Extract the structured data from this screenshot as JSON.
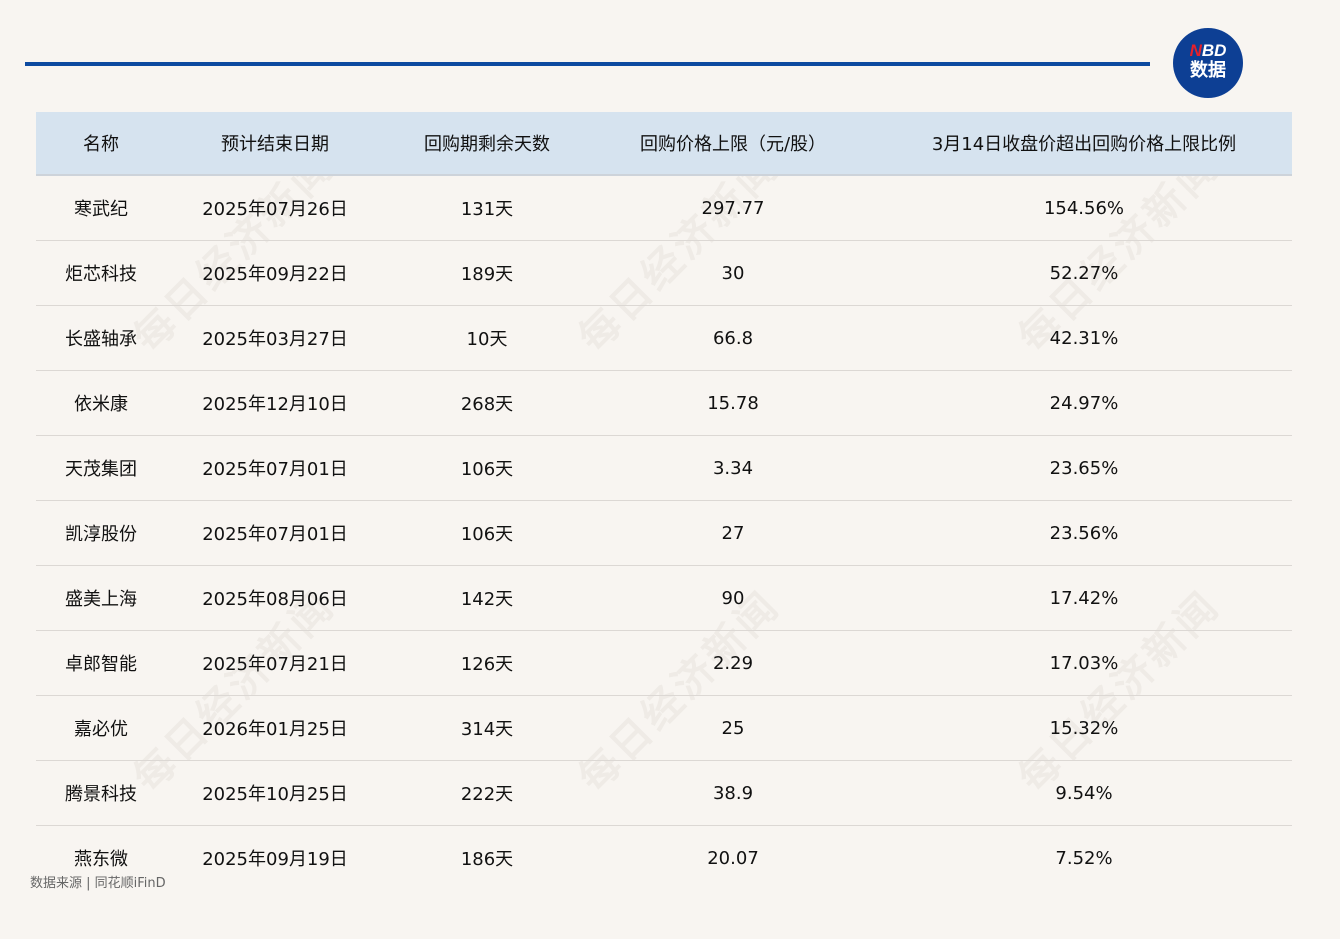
{
  "logo": {
    "brand_n": "N",
    "brand_bd": "BD",
    "subtitle": "数据"
  },
  "watermark": "每日经济新闻",
  "table": {
    "headers": [
      "名称",
      "预计结束日期",
      "回购期剩余天数",
      "回购价格上限（元/股）",
      "3月14日收盘价超出回购价格上限比例"
    ],
    "rows": [
      [
        "寒武纪",
        "2025年07月26日",
        "131天",
        "297.77",
        "154.56%"
      ],
      [
        "炬芯科技",
        "2025年09月22日",
        "189天",
        "30",
        "52.27%"
      ],
      [
        "长盛轴承",
        "2025年03月27日",
        "10天",
        "66.8",
        "42.31%"
      ],
      [
        "依米康",
        "2025年12月10日",
        "268天",
        "15.78",
        "24.97%"
      ],
      [
        "天茂集团",
        "2025年07月01日",
        "106天",
        "3.34",
        "23.65%"
      ],
      [
        "凯淳股份",
        "2025年07月01日",
        "106天",
        "27",
        "23.56%"
      ],
      [
        "盛美上海",
        "2025年08月06日",
        "142天",
        "90",
        "17.42%"
      ],
      [
        "卓郎智能",
        "2025年07月21日",
        "126天",
        "2.29",
        "17.03%"
      ],
      [
        "嘉必优",
        "2026年01月25日",
        "314天",
        "25",
        "15.32%"
      ],
      [
        "腾景科技",
        "2025年10月25日",
        "222天",
        "38.9",
        "9.54%"
      ],
      [
        "燕东微",
        "2025年09月19日",
        "186天",
        "20.07",
        "7.52%"
      ]
    ]
  },
  "footer": "数据来源 | 同花顺iFinD"
}
